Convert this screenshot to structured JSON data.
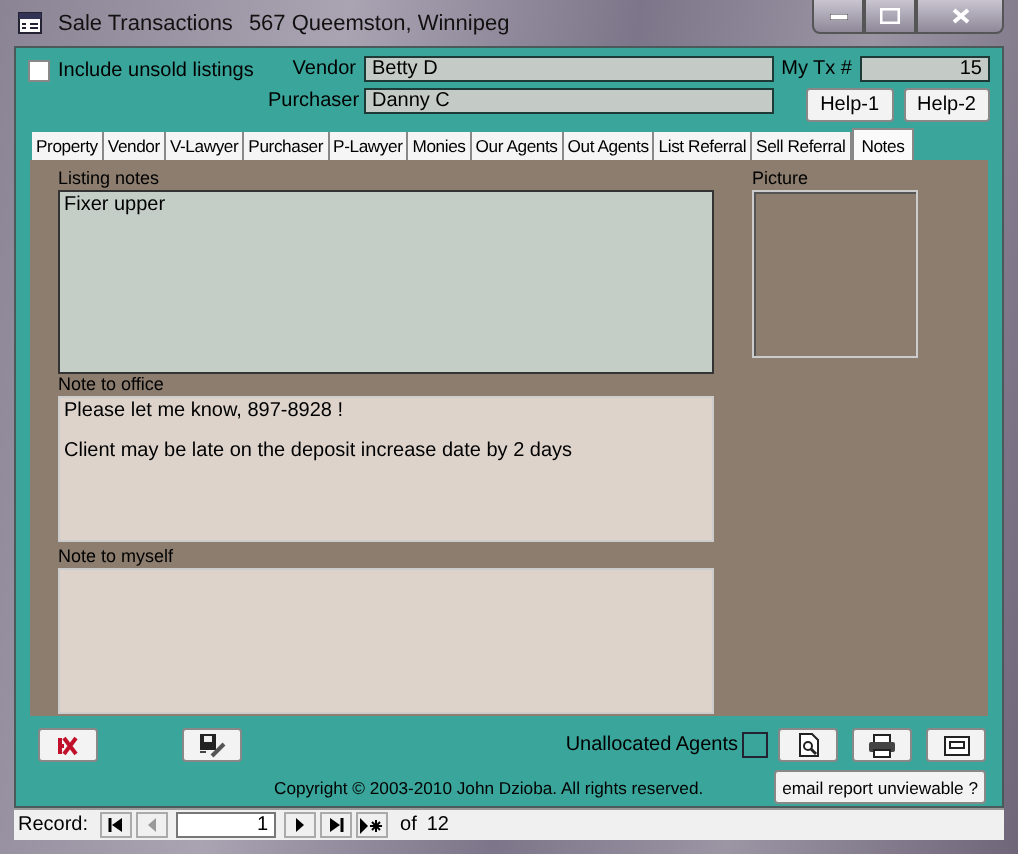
{
  "window": {
    "title": "Sale Transactions",
    "subtitle": "567 Queemston, Winnipeg"
  },
  "include_unsold": {
    "label": "Include unsold listings",
    "checked": false
  },
  "vendor": {
    "label": "Vendor",
    "value": "Betty D"
  },
  "purchaser": {
    "label": "Purchaser",
    "value": "Danny C"
  },
  "my_tx": {
    "label": "My Tx #",
    "value": "15"
  },
  "help_buttons": [
    "Help-1",
    "Help-2"
  ],
  "tabs": [
    {
      "label": "Property",
      "selected": false
    },
    {
      "label": "Vendor",
      "selected": false
    },
    {
      "label": "V-Lawyer",
      "selected": false
    },
    {
      "label": "Purchaser",
      "selected": false
    },
    {
      "label": "P-Lawyer",
      "selected": false
    },
    {
      "label": "Monies",
      "selected": false
    },
    {
      "label": "Our Agents",
      "selected": false
    },
    {
      "label": "Out Agents",
      "selected": false
    },
    {
      "label": "List Referral",
      "selected": false
    },
    {
      "label": "Sell Referral",
      "selected": false
    },
    {
      "label": "Notes",
      "selected": true
    }
  ],
  "listing_notes": {
    "label": "Listing notes",
    "paragraphs": [
      "Fixer upper"
    ]
  },
  "picture": {
    "label": "Picture"
  },
  "note_to_office": {
    "label": "Note to office",
    "paragraphs": [
      "Please let me know, 897-8928 !",
      "Client may be late on the deposit increase date by 2 days"
    ]
  },
  "note_to_myself": {
    "label": "Note to myself"
  },
  "unallocated_agents": {
    "label": "Unallocated Agents",
    "checked": false
  },
  "email_button": "email report unviewable ?",
  "copyright": "Copyright © 2003-2010 John Dzioba. All rights reserved.",
  "record_nav": {
    "label": "Record:",
    "value": "1",
    "of": "of",
    "total": "12"
  }
}
